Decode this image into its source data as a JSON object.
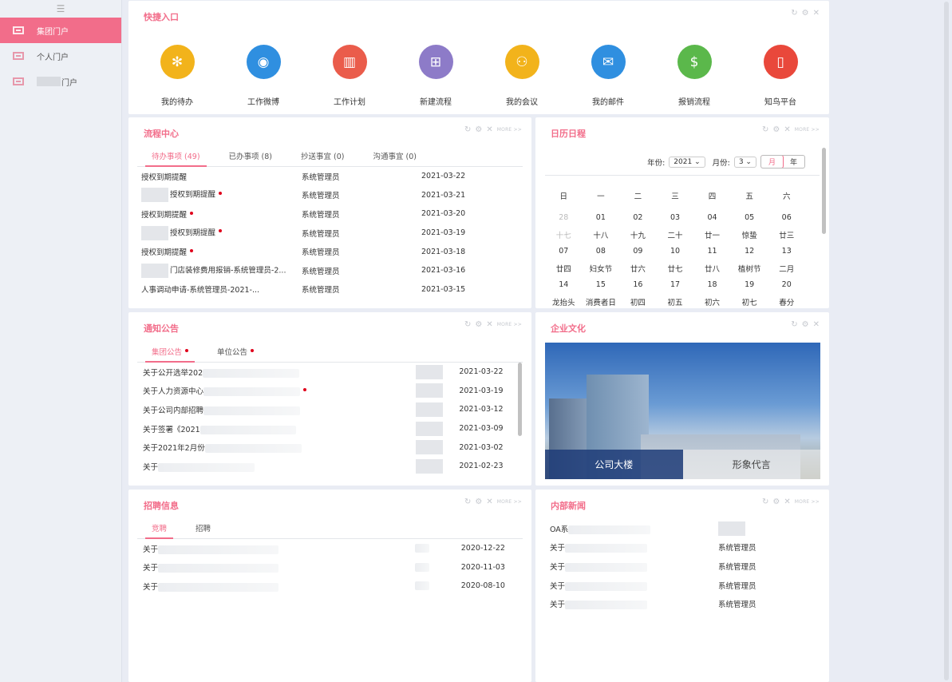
{
  "sidebar": {
    "items": [
      {
        "label": "集团门户",
        "active": true
      },
      {
        "label": "个人门户",
        "active": false
      },
      {
        "label": "门户",
        "active": false
      }
    ]
  },
  "controls": {
    "more": "MORE >>"
  },
  "quick": {
    "title": "快捷入口",
    "items": [
      {
        "label": "我的待办",
        "icon": "sparkle-icon",
        "color": "#f2b31b"
      },
      {
        "label": "工作微博",
        "icon": "chat-icon",
        "color": "#2f8fe0"
      },
      {
        "label": "工作计划",
        "icon": "chart-icon",
        "color": "#ea5c4b"
      },
      {
        "label": "新建流程",
        "icon": "flow-icon",
        "color": "#8d7bc8"
      },
      {
        "label": "我的会议",
        "icon": "people-icon",
        "color": "#f2b31b"
      },
      {
        "label": "我的邮件",
        "icon": "mail-icon",
        "color": "#2f8fe0"
      },
      {
        "label": "报销流程",
        "icon": "money-icon",
        "color": "#5bb84b"
      },
      {
        "label": "知鸟平台",
        "icon": "phone-icon",
        "color": "#e9483b"
      }
    ]
  },
  "process": {
    "title": "流程中心",
    "tabs": [
      "待办事项 (49)",
      "已办事项 (8)",
      "抄送事宜 (0)",
      "沟通事宜 (0)"
    ],
    "rows": [
      {
        "title": "授权到期提醒",
        "user": "系统管理员",
        "date": "2021-03-22",
        "dot": false
      },
      {
        "title": "授权到期提醒",
        "user": "系统管理员",
        "date": "2021-03-21",
        "dot": true
      },
      {
        "title": "授权到期提醒",
        "user": "系统管理员",
        "date": "2021-03-20",
        "dot": true
      },
      {
        "title": "授权到期提醒",
        "user": "系统管理员",
        "date": "2021-03-19",
        "dot": true
      },
      {
        "title": "授权到期提醒",
        "user": "系统管理员",
        "date": "2021-03-18",
        "dot": true
      },
      {
        "title": "门店装修费用报销-系统管理员-2...",
        "user": "系统管理员",
        "date": "2021-03-16",
        "dot": false
      },
      {
        "title": "人事调动申请-系统管理员-2021-...",
        "user": "系统管理员",
        "date": "2021-03-15",
        "dot": false
      }
    ]
  },
  "calendar": {
    "title": "日历日程",
    "year_label": "年份:",
    "year": "2021",
    "month_label": "月份:",
    "month": "3",
    "view_month": "月",
    "view_year": "年",
    "weekdays": [
      "日",
      "一",
      "二",
      "三",
      "四",
      "五",
      "六"
    ],
    "weeks": [
      {
        "days": [
          "28",
          "01",
          "02",
          "03",
          "04",
          "05",
          "06"
        ],
        "lunar": [
          "十七",
          "十八",
          "十九",
          "二十",
          "廿一",
          "惊蛰",
          "廿三"
        ]
      },
      {
        "days": [
          "07",
          "08",
          "09",
          "10",
          "11",
          "12",
          "13"
        ],
        "lunar": [
          "廿四",
          "妇女节",
          "廿六",
          "廿七",
          "廿八",
          "植树节",
          "二月"
        ]
      },
      {
        "days": [
          "14",
          "15",
          "16",
          "17",
          "18",
          "19",
          "20"
        ],
        "lunar": [
          "龙抬头",
          "消费者日",
          "初四",
          "初五",
          "初六",
          "初七",
          "春分"
        ]
      }
    ]
  },
  "notice": {
    "title": "通知公告",
    "tabs": [
      "集团公告",
      "单位公告"
    ],
    "rows": [
      {
        "title": "关于公开选举202",
        "date": "2021-03-22"
      },
      {
        "title": "关于人力资源中心",
        "date": "2021-03-19"
      },
      {
        "title": "关于公司内部招聘",
        "date": "2021-03-12"
      },
      {
        "title": "关于签署《2021",
        "date": "2021-03-09"
      },
      {
        "title": "关于2021年2月份",
        "date": "2021-03-02"
      },
      {
        "title": "关于",
        "date": "2021-02-23"
      }
    ]
  },
  "culture": {
    "title": "企业文化",
    "captions": [
      "公司大楼",
      "形象代言"
    ]
  },
  "recruit": {
    "title": "招聘信息",
    "tabs": [
      "竞聘",
      "招聘"
    ],
    "rows": [
      {
        "title": "关于",
        "date": "2020-12-22"
      },
      {
        "title": "关于",
        "date": "2020-11-03"
      },
      {
        "title": "关于",
        "date": "2020-08-10"
      }
    ]
  },
  "news": {
    "title": "内部新闻",
    "rows": [
      {
        "title": "OA系",
        "user": ""
      },
      {
        "title": "关于",
        "user": "系统管理员"
      },
      {
        "title": "关于",
        "user": "系统管理员"
      },
      {
        "title": "关于",
        "user": "系统管理员"
      },
      {
        "title": "关于",
        "user": "系统管理员"
      }
    ]
  }
}
